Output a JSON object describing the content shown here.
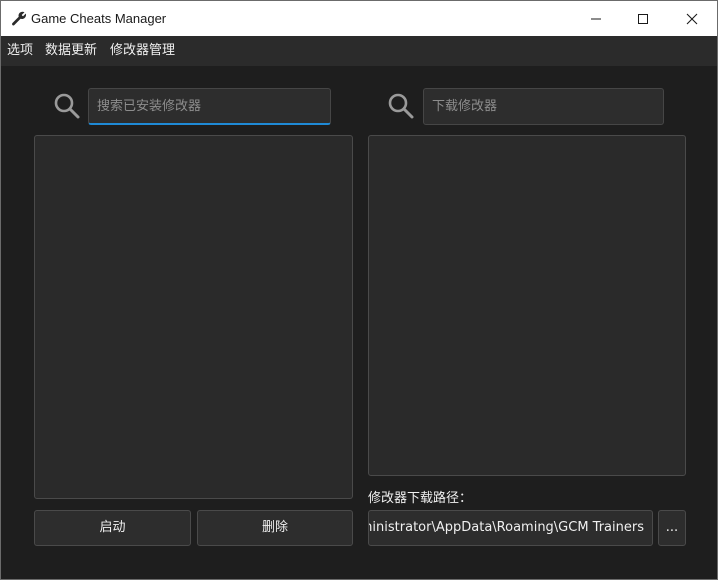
{
  "window": {
    "title": "Game Cheats Manager"
  },
  "menu": {
    "items": [
      "选项",
      "数据更新",
      "修改器管理"
    ]
  },
  "installed": {
    "search_placeholder": "搜索已安装修改器",
    "launch_label": "启动",
    "delete_label": "删除"
  },
  "download": {
    "search_placeholder": "下载修改器",
    "path_label": "修改器下载路径：",
    "path_value": "C:\\Users\\Administrator\\AppData\\Roaming\\GCM Trainers",
    "browse_label": "..."
  },
  "icons": {
    "app": "wrench-icon",
    "search": "search-icon",
    "minimize": "minimize-icon",
    "maximize": "maximize-icon",
    "close": "close-icon"
  },
  "colors": {
    "background": "#1e1e1e",
    "menubar": "#2b2b2b",
    "panel": "#2a2a2a",
    "accent": "#1f8ad6",
    "titlebar": "#ffffff"
  }
}
